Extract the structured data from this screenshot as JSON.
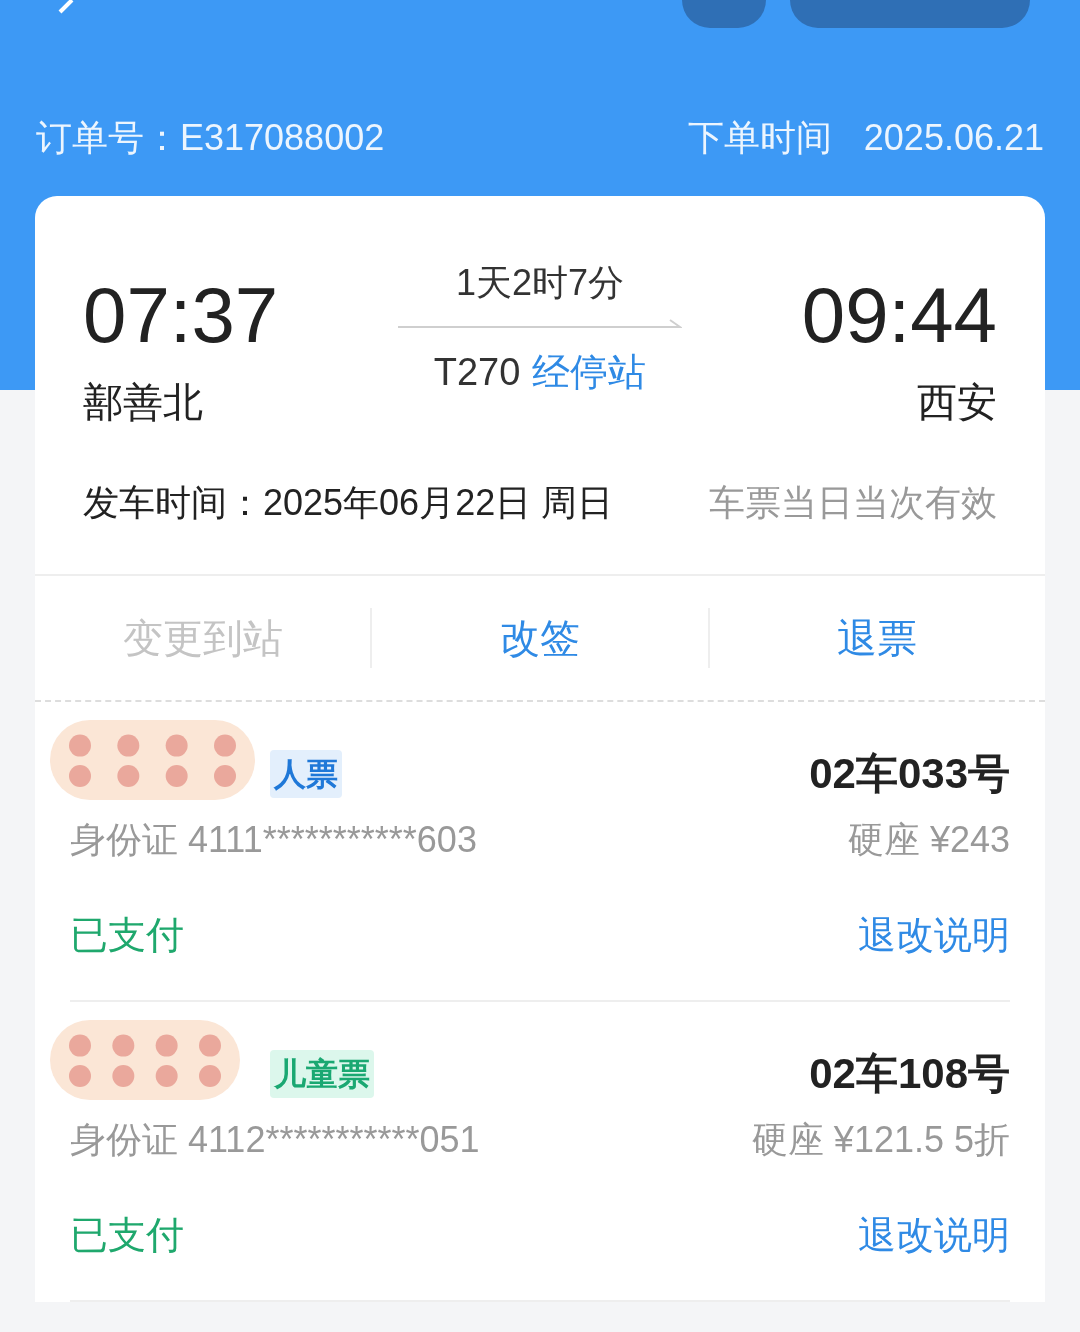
{
  "header": {
    "order_label": "订单号：",
    "order_no": "E317088002",
    "time_label": "下单时间",
    "time": "2025.06.21"
  },
  "trip": {
    "depart_time": "07:37",
    "depart_station": "鄯善北",
    "duration": "1天2时7分",
    "train": "T270",
    "stops_link": "经停站",
    "arrive_time": "09:44",
    "arrive_station": "西安",
    "date_label": "发车时间：",
    "date": "2025年06月22日 周日",
    "validity": "车票当日当次有效"
  },
  "actions": [
    {
      "label": "变更到站",
      "disabled": true
    },
    {
      "label": "改签",
      "disabled": false
    },
    {
      "label": "退票",
      "disabled": false
    }
  ],
  "passengers": [
    {
      "ticket_type": "人票",
      "kind": "adult",
      "id": "身份证 4111***********603",
      "seat": "02车033号",
      "fare": "硬座 ¥243",
      "status": "已支付",
      "link": "退改说明"
    },
    {
      "ticket_type": "儿童票",
      "kind": "child",
      "id": "身份证 4112***********051",
      "seat": "02车108号",
      "fare": "硬座 ¥121.5 5折",
      "status": "已支付",
      "link": "退改说明"
    }
  ]
}
